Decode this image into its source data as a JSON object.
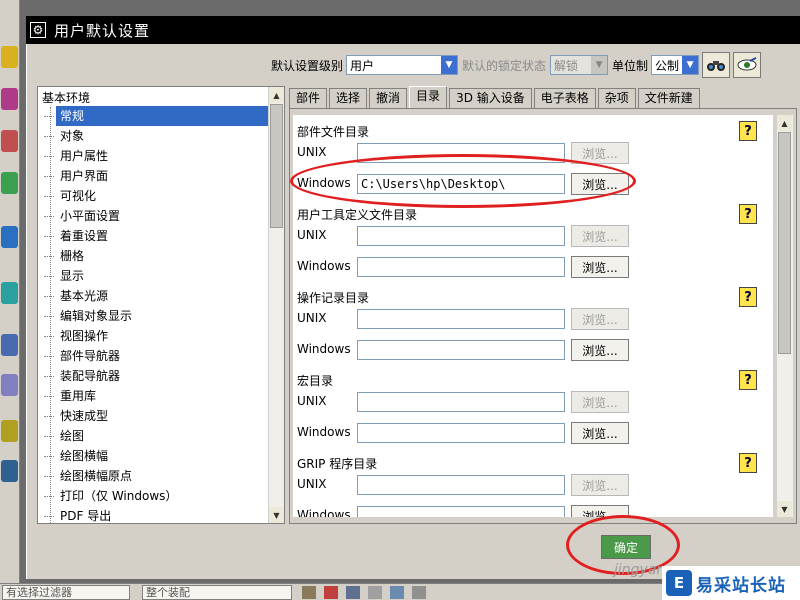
{
  "window": {
    "title": "用户默认设置",
    "title_icon": "gear-icon"
  },
  "toolbar": {
    "level_label": "默认设置级别",
    "level_value": "用户",
    "lock_label": "默认的锁定状态",
    "lock_value": "解锁",
    "unit_label": "单位制",
    "unit_value": "公制",
    "btn1_icon": "binoculars-icon",
    "btn2_icon": "eye-icon"
  },
  "tree": {
    "root": "基本环境",
    "items": [
      "常规",
      "对象",
      "用户属性",
      "用户界面",
      "可视化",
      "小平面设置",
      "着重设置",
      "栅格",
      "显示",
      "基本光源",
      "编辑对象显示",
      "视图操作",
      "部件导航器",
      "装配导航器",
      "重用库",
      "快速成型",
      "绘图",
      "绘图横幅",
      "绘图横幅原点",
      "打印（仅 Windows）",
      "PDF 导出"
    ],
    "selected_index": 0
  },
  "tabs": {
    "items": [
      "部件",
      "选择",
      "撤消",
      "目录",
      "3D 输入设备",
      "电子表格",
      "杂项",
      "文件新建"
    ],
    "active_index": 3
  },
  "sections": [
    {
      "title": "部件文件目录",
      "unix_label": "UNIX",
      "unix_value": "",
      "windows_label": "Windows",
      "windows_value": "C:\\Users\\hp\\Desktop\\",
      "browse_label": "浏览..."
    },
    {
      "title": "用户工具定义文件目录",
      "unix_label": "UNIX",
      "unix_value": "",
      "windows_label": "Windows",
      "windows_value": "",
      "browse_label": "浏览..."
    },
    {
      "title": "操作记录目录",
      "unix_label": "UNIX",
      "unix_value": "",
      "windows_label": "Windows",
      "windows_value": "",
      "browse_label": "浏览..."
    },
    {
      "title": "宏目录",
      "unix_label": "UNIX",
      "unix_value": "",
      "windows_label": "Windows",
      "windows_value": "",
      "browse_label": "浏览..."
    },
    {
      "title": "GRIP 程序目录",
      "unix_label": "UNIX",
      "unix_value": "",
      "windows_label": "Windows",
      "windows_value": "",
      "browse_label": "浏览..."
    }
  ],
  "help_label": "?",
  "ok_label": "确定",
  "statusbar": {
    "filter_text": "有选择过滤器",
    "assembly_text": "整个装配"
  },
  "watermark": {
    "brand": "易采站长站",
    "logo_char": "E",
    "jingyan": "jingyan"
  },
  "colors": {
    "title_bar": "#000000",
    "selection": "#316ac5",
    "annotation_red": "#e02020",
    "help_yellow": "#ffe44d"
  }
}
